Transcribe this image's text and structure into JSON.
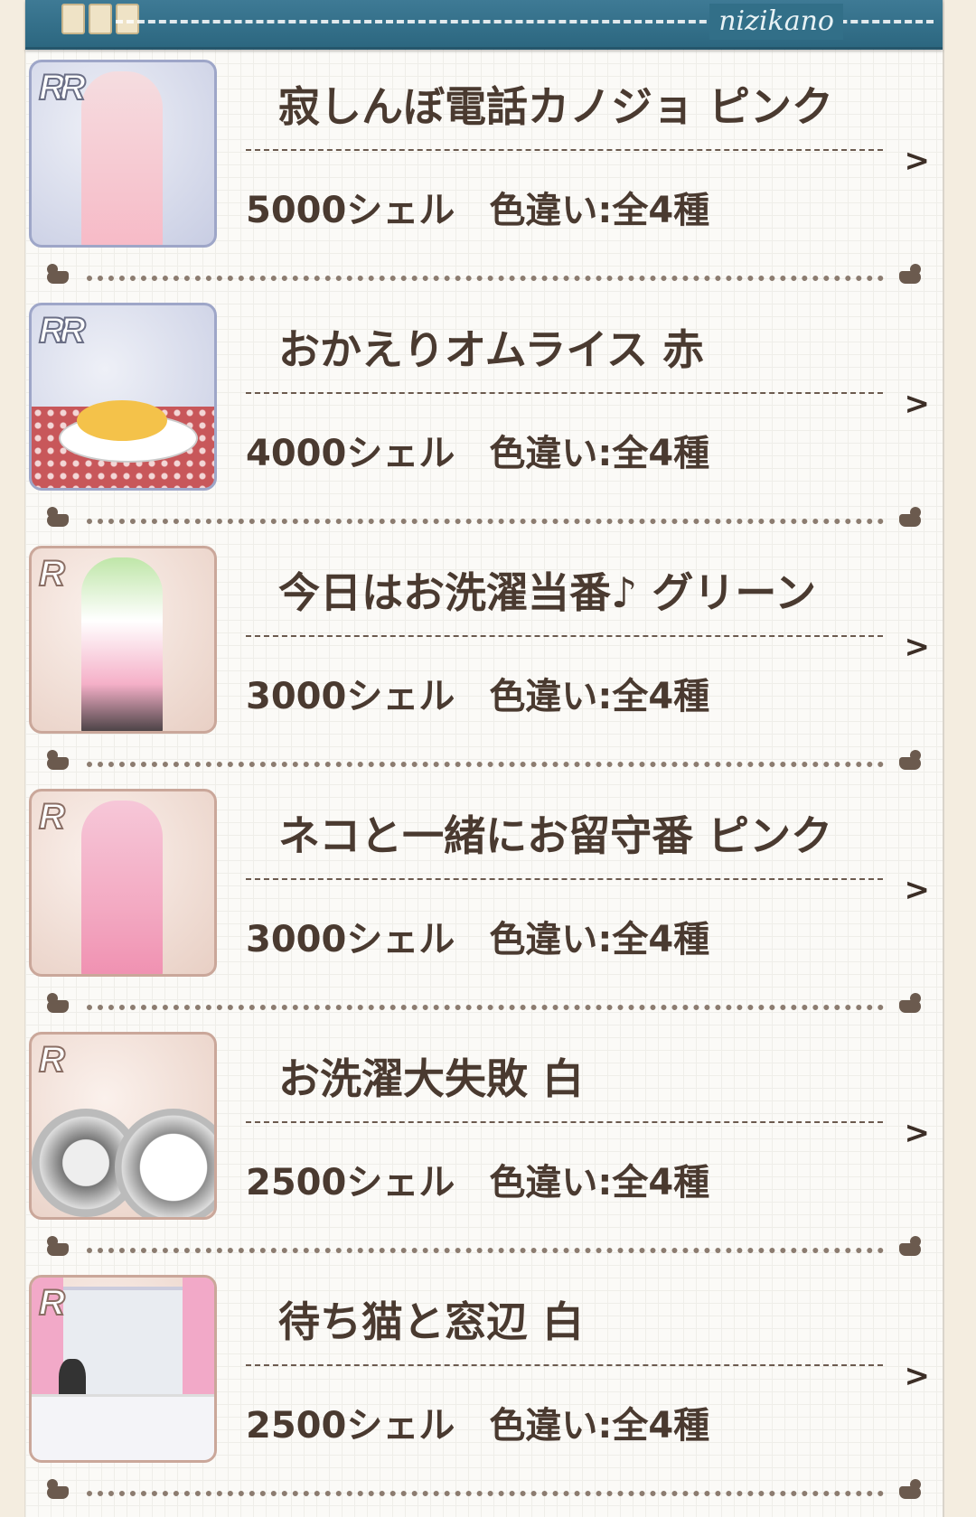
{
  "header": {
    "brand": "nizikano"
  },
  "items": [
    {
      "rarity": "RR",
      "title": "寂しんぼ電話カノジョ ピンク",
      "price": "5000シェル",
      "variants": "色違い:全4種",
      "thumb": "pink-shirt-girl"
    },
    {
      "rarity": "RR",
      "title": "おかえりオムライス 赤",
      "price": "4000シェル",
      "variants": "色違い:全4種",
      "thumb": "omurice-plate"
    },
    {
      "rarity": "R",
      "title": "今日はお洗濯当番♪ グリーン",
      "price": "3000シェル",
      "variants": "色違い:全4種",
      "thumb": "laundry-basket-girl"
    },
    {
      "rarity": "R",
      "title": "ネコと一緒にお留守番 ピンク",
      "price": "3000シェル",
      "variants": "色違い:全4種",
      "thumb": "girl-holding-cat"
    },
    {
      "rarity": "R",
      "title": "お洗濯大失敗 白",
      "price": "2500シェル",
      "variants": "色違い:全4種",
      "thumb": "washing-machine"
    },
    {
      "rarity": "R",
      "title": "待ち猫と窓辺 白",
      "price": "2500シェル",
      "variants": "色違い:全4種",
      "thumb": "cat-by-window"
    }
  ],
  "colors": {
    "header_blue": "#2f6f89",
    "text_brown": "#4a3a30"
  }
}
